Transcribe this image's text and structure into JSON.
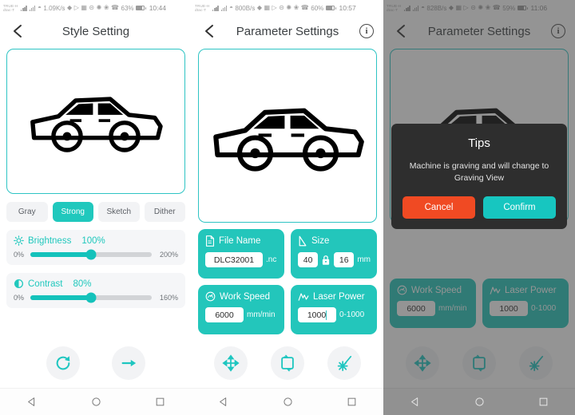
{
  "panels": [
    {
      "status": {
        "carrier_line1": "TRUE-H",
        "carrier_line2": "dtac-T",
        "data_rate": "1.09K/s",
        "battery": "63%",
        "clock": "10:44"
      },
      "appbar": {
        "title": "Style Setting",
        "back_icon": "chevron-left-icon",
        "info_icon": null
      },
      "preview": {
        "image": "car-line-art"
      },
      "chips": [
        {
          "label": "Gray",
          "active": false
        },
        {
          "label": "Strong",
          "active": true
        },
        {
          "label": "Sketch",
          "active": false
        },
        {
          "label": "Dither",
          "active": false
        }
      ],
      "sliders": [
        {
          "icon": "brightness-icon",
          "label": "Brightness",
          "value": "100%",
          "min_label": "0%",
          "max_label": "200%",
          "percent": 50
        },
        {
          "icon": "contrast-icon",
          "label": "Contrast",
          "value": "80%",
          "min_label": "0%",
          "max_label": "160%",
          "percent": 50
        }
      ],
      "toolbar": [
        {
          "icon": "rotate-refresh-icon",
          "name": "rotate-button"
        },
        {
          "icon": "arrow-right-icon",
          "name": "next-button"
        }
      ]
    },
    {
      "status": {
        "carrier_line1": "TRUE-H",
        "carrier_line2": "dtac-T",
        "data_rate": "800B/s",
        "battery": "60%",
        "clock": "10:57"
      },
      "appbar": {
        "title": "Parameter Settings",
        "back_icon": "chevron-left-icon",
        "info_icon": "info-circle-icon"
      },
      "preview": {
        "image": "car-line-art"
      },
      "params": {
        "file_name": {
          "icon": "file-icon",
          "label": "File Name",
          "value": "DLC32001",
          "suffix": ".nc"
        },
        "size": {
          "icon": "size-diagonal-icon",
          "label": "Size",
          "width": "40",
          "height": "16",
          "suffix": "mm",
          "lock_icon": "lock-icon"
        },
        "work_speed": {
          "icon": "speedometer-icon",
          "label": "Work Speed",
          "value": "6000",
          "suffix": "mm/min"
        },
        "laser_power": {
          "icon": "laser-power-icon",
          "label": "Laser Power",
          "value": "1000",
          "suffix": "0-1000"
        }
      },
      "toolbar": [
        {
          "icon": "move-arrows-icon",
          "name": "move-button"
        },
        {
          "icon": "frame-boundary-icon",
          "name": "frame-button"
        },
        {
          "icon": "engrave-laser-icon",
          "name": "engrave-button"
        }
      ]
    },
    {
      "status": {
        "carrier_line1": "TRUE-H",
        "carrier_line2": "dtac-T",
        "data_rate": "828B/s",
        "battery": "59%",
        "clock": "11:06"
      },
      "appbar": {
        "title": "Parameter Settings",
        "back_icon": "chevron-left-icon",
        "info_icon": "info-circle-icon"
      },
      "preview": {
        "image": "car-line-art"
      },
      "params": {
        "work_speed": {
          "icon": "speedometer-icon",
          "label": "Work Speed",
          "value": "6000",
          "suffix": "mm/min"
        },
        "laser_power": {
          "icon": "laser-power-icon",
          "label": "Laser Power",
          "value": "1000",
          "suffix": "0-1000"
        }
      },
      "dialog": {
        "title": "Tips",
        "message": "Machine is graving and will change to Graving View",
        "cancel_label": "Cancel",
        "confirm_label": "Confirm"
      },
      "toolbar": [
        {
          "icon": "move-arrows-icon",
          "name": "move-button"
        },
        {
          "icon": "frame-boundary-icon",
          "name": "frame-button"
        },
        {
          "icon": "engrave-laser-icon",
          "name": "engrave-button"
        }
      ]
    }
  ],
  "navbar": {
    "back_icon": "nav-back-triangle-icon",
    "home_icon": "nav-home-circle-icon",
    "recents_icon": "nav-recents-square-icon"
  },
  "colors": {
    "accent": "#20c8bd",
    "accent_dark": "#14c2bb",
    "card": "#23c6bb",
    "danger": "#f04a23",
    "dialog_bg": "#2e2e2e",
    "chip_bg": "#f2f3f5"
  }
}
